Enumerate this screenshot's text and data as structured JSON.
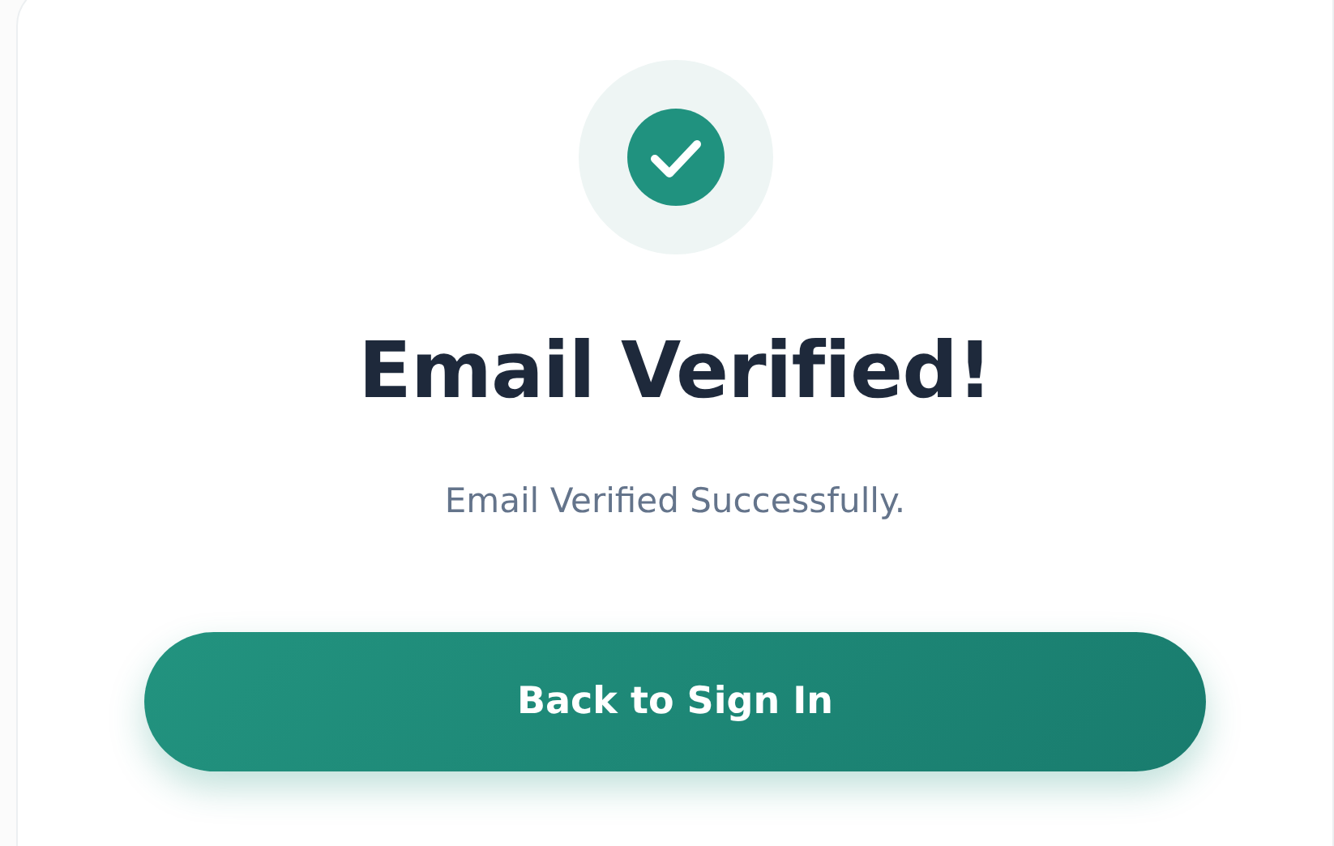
{
  "status": {
    "kind": "success"
  },
  "title": "Email Verified!",
  "message": "Email Verified Successfully.",
  "button": {
    "label": "Back to Sign In"
  }
}
